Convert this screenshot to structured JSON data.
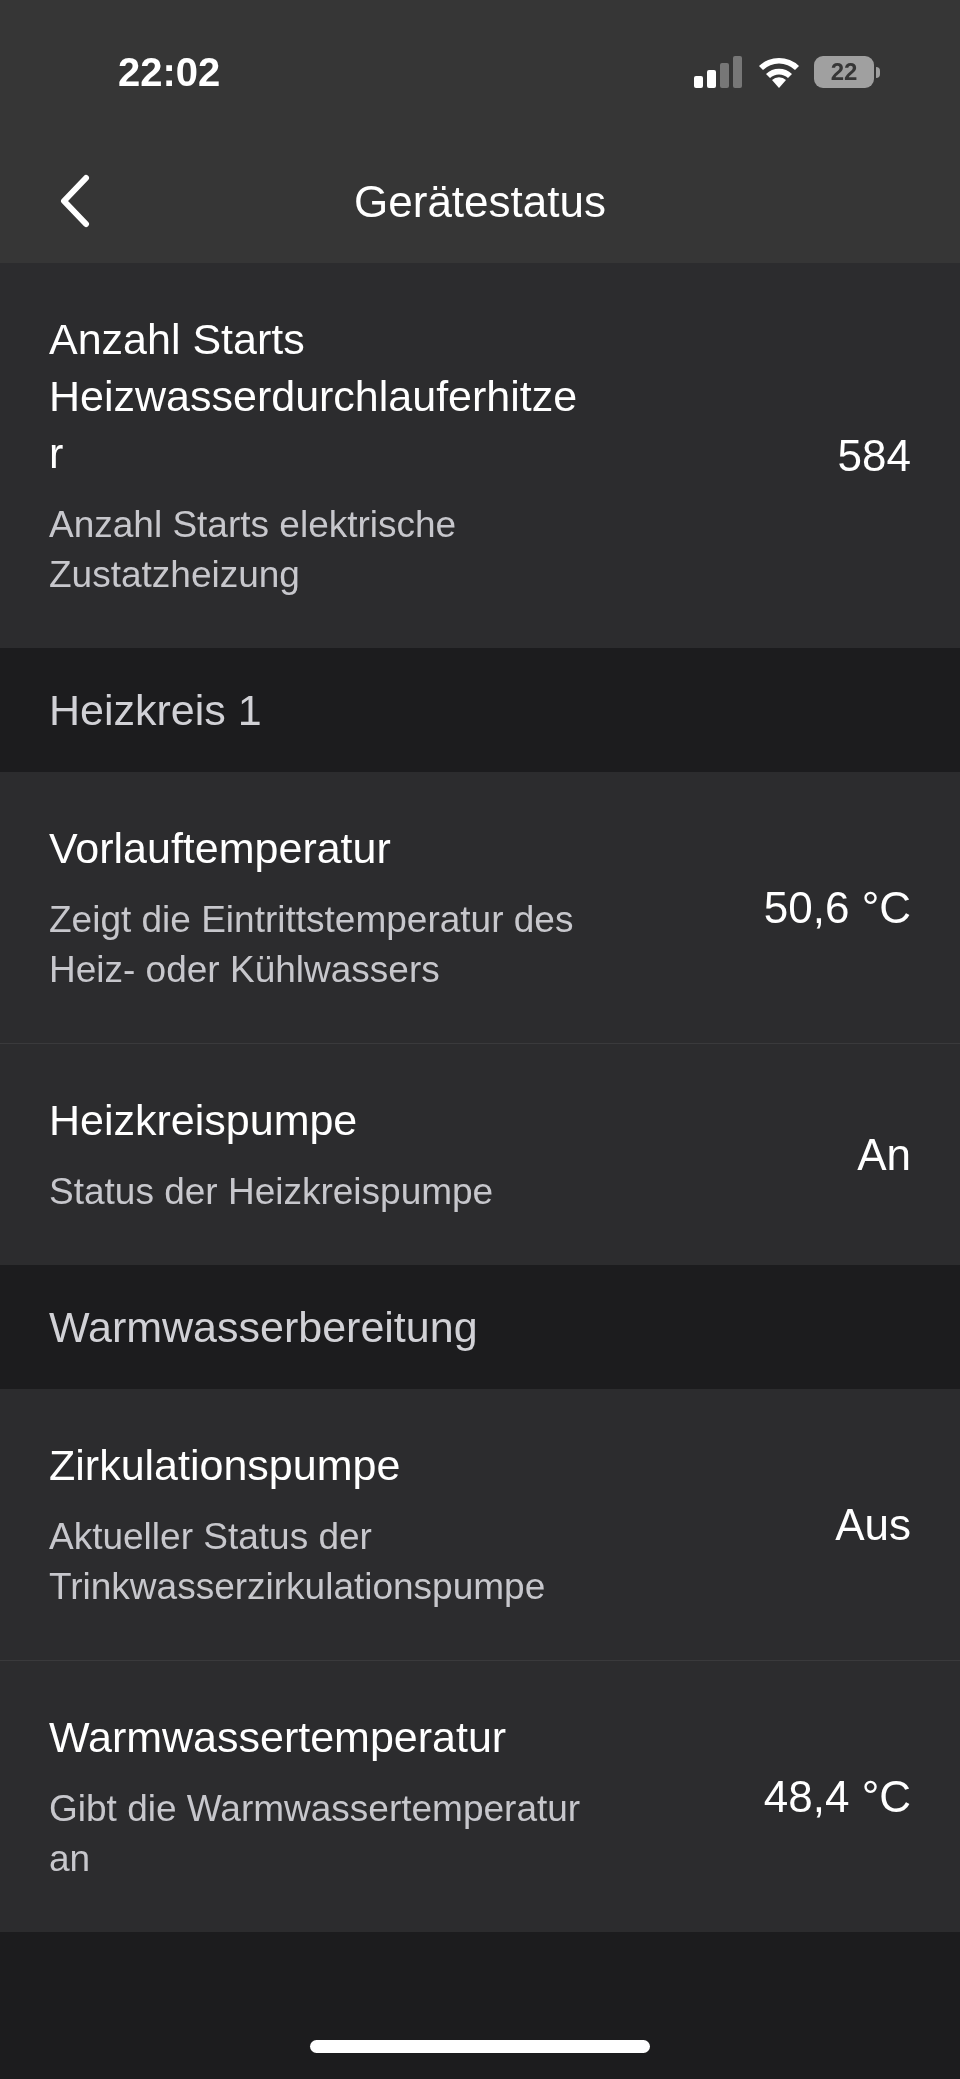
{
  "status_bar": {
    "time": "22:02",
    "battery": "22"
  },
  "nav": {
    "title": "Gerätestatus"
  },
  "sections": [
    {
      "kind": "rows",
      "rows": [
        {
          "title": "Anzahl Starts Heizwasserdurchlauferhitze r",
          "subtitle": "Anzahl Starts elektrische Zustatzheizung",
          "value": "584"
        }
      ]
    },
    {
      "kind": "header",
      "title": "Heizkreis 1"
    },
    {
      "kind": "rows",
      "rows": [
        {
          "title": "Vorlauftemperatur",
          "subtitle": "Zeigt die Eintrittstemperatur des Heiz- oder Kühlwassers",
          "value": "50,6 °C"
        },
        {
          "title": "Heizkreispumpe",
          "subtitle": "Status der Heizkreispumpe",
          "value": "An"
        }
      ]
    },
    {
      "kind": "header",
      "title": "Warmwasserbereitung"
    },
    {
      "kind": "rows",
      "rows": [
        {
          "title": "Zirkulationspumpe",
          "subtitle": "Aktueller Status der Trinkwasserzirkulationspumpe",
          "value": "Aus"
        },
        {
          "title": "Warmwassertemperatur",
          "subtitle": "Gibt die Warmwassertemperatur an",
          "value": "48,4 °C"
        }
      ]
    }
  ]
}
